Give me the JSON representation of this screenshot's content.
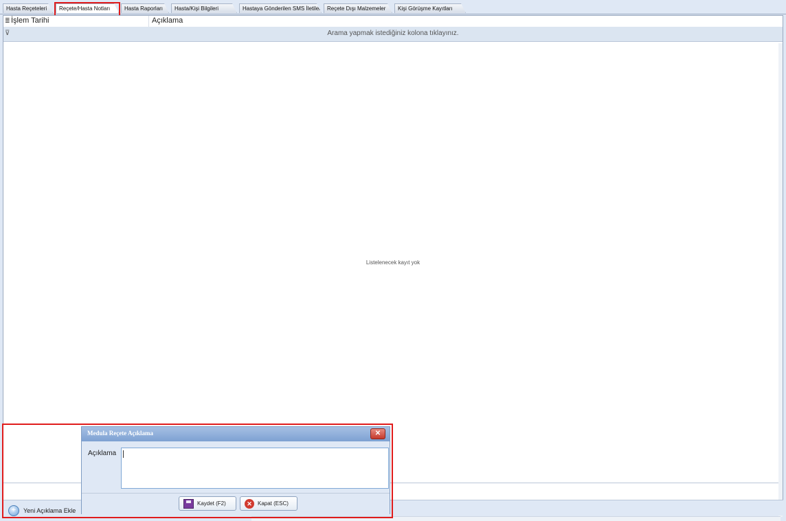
{
  "tabs": [
    "Hasta Reçeteleri",
    "Reçete/Hasta Notları",
    "Hasta Raporları",
    "Hasta/Kişi Bilgileri",
    "Hastaya Gönderilen SMS İletileri",
    "Reçete Dışı Malzemeler",
    "Kişi Görüşme Kayıtları"
  ],
  "grid": {
    "columns": [
      "İşlem Tarihi",
      "Açıklama"
    ],
    "filter_hint": "Arama yapmak istediğiniz kolona tıklayınız.",
    "empty_text": "Listelenecek kayıt yok"
  },
  "bottom": {
    "add_label": "Yeni Açıklama Ekle"
  },
  "dialog": {
    "title": "Medula Reçete Açıklama",
    "field_label": "Açıklama",
    "field_value": "",
    "save_label": "Kaydet (F2)",
    "close_label": "Kapat (ESC)"
  },
  "colors": {
    "highlight": "#e01b1b"
  }
}
